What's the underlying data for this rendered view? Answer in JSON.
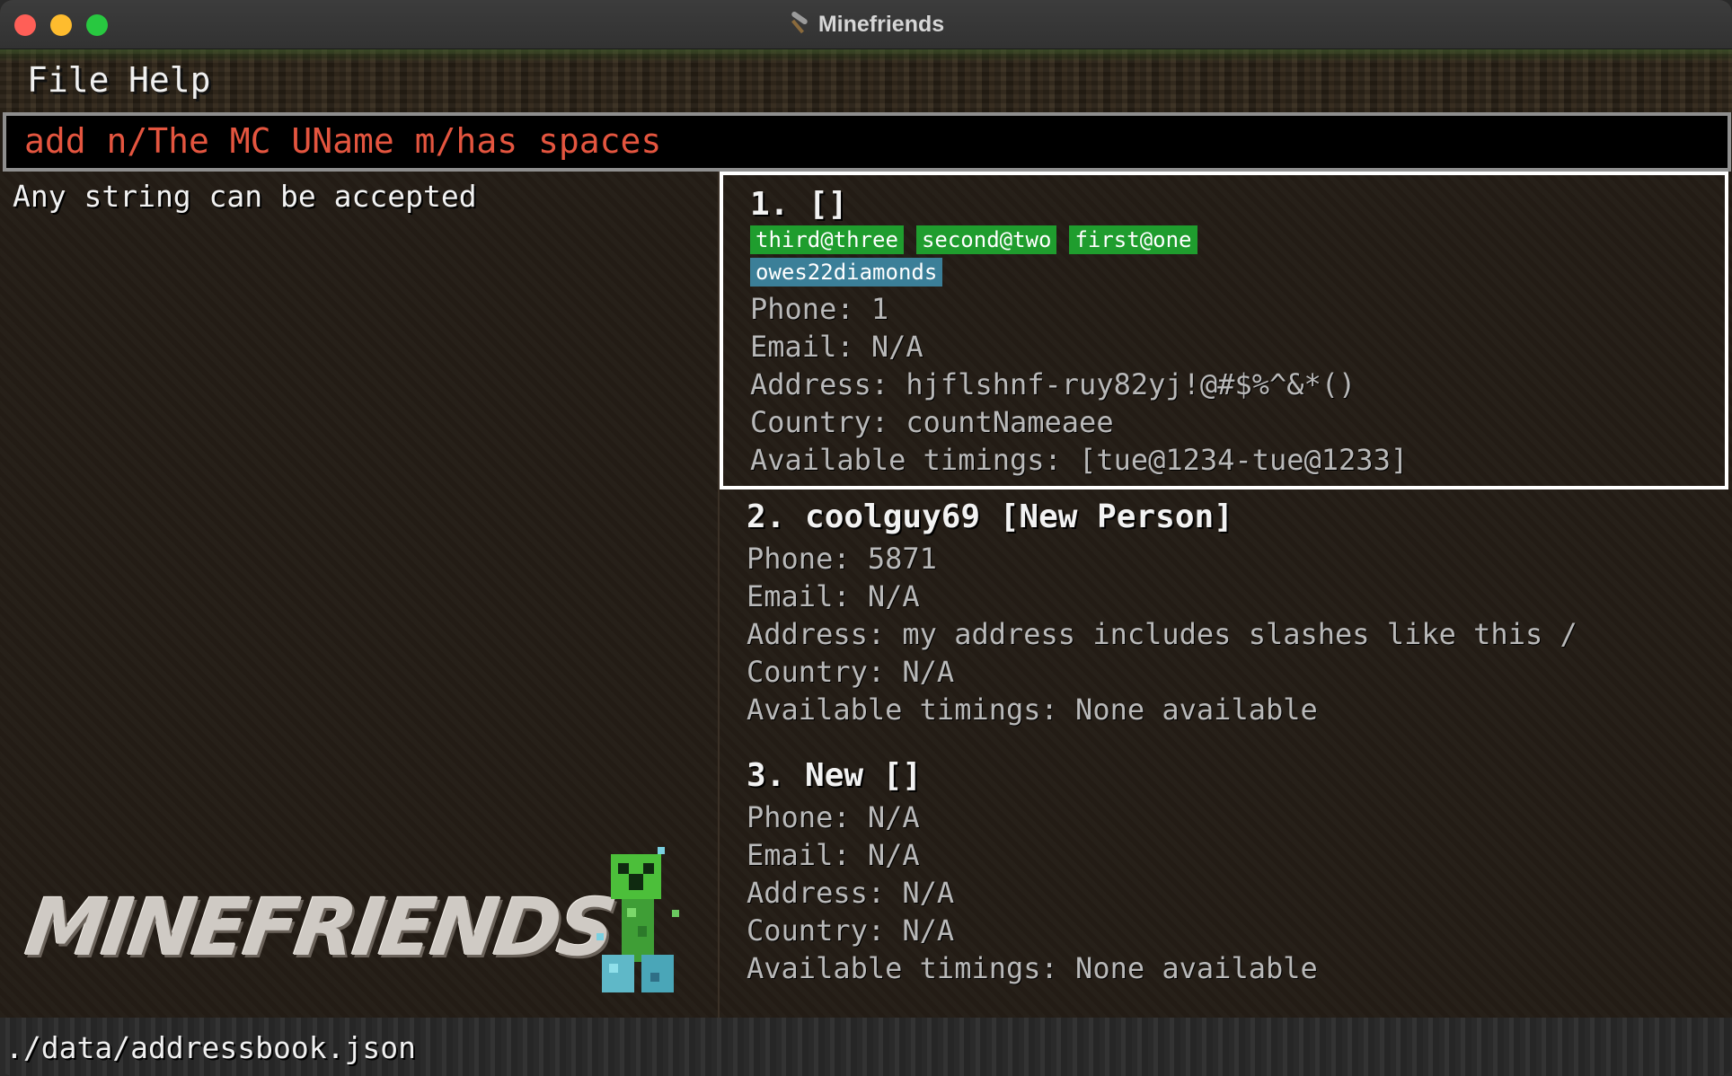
{
  "window": {
    "title": "Minefriends"
  },
  "menu": {
    "items": [
      "File",
      "Help"
    ]
  },
  "command_box": {
    "value": "add n/The MC UName m/has spaces"
  },
  "result_display": {
    "text": "Any string can be accepted"
  },
  "logo": {
    "text": "MINEFRIENDS"
  },
  "persons": [
    {
      "title": "1.  []",
      "tags": [
        {
          "label": "third@three",
          "color": "#1f9d2e"
        },
        {
          "label": "second@two",
          "color": "#1f9d2e"
        },
        {
          "label": "first@one",
          "color": "#1f9d2e"
        },
        {
          "label": "owes22diamonds",
          "color": "#3b7f98"
        }
      ],
      "phone": "Phone: 1",
      "email": "Email: N/A",
      "address": "Address: hjflshnf-ruy82yj!@#$%^&*()",
      "country": "Country: countNameaee",
      "timings": "Available timings: [tue@1234-tue@1233]"
    },
    {
      "title": "2.  coolguy69 [New Person]",
      "tags": [],
      "phone": "Phone: 5871",
      "email": "Email: N/A",
      "address": "Address: my address includes slashes like this /",
      "country": "Country: N/A",
      "timings": "Available timings: None available"
    },
    {
      "title": "3.  New []",
      "tags": [],
      "phone": "Phone: N/A",
      "email": "Email: N/A",
      "address": "Address: N/A",
      "country": "Country: N/A",
      "timings": "Available timings: None available"
    }
  ],
  "status_bar": {
    "path": "./data/addressbook.json"
  },
  "colors": {
    "accent_command": "#e4553f",
    "tag_green": "#1f9d2e",
    "tag_blue": "#3b7f98",
    "selected_border": "#ffffff"
  }
}
